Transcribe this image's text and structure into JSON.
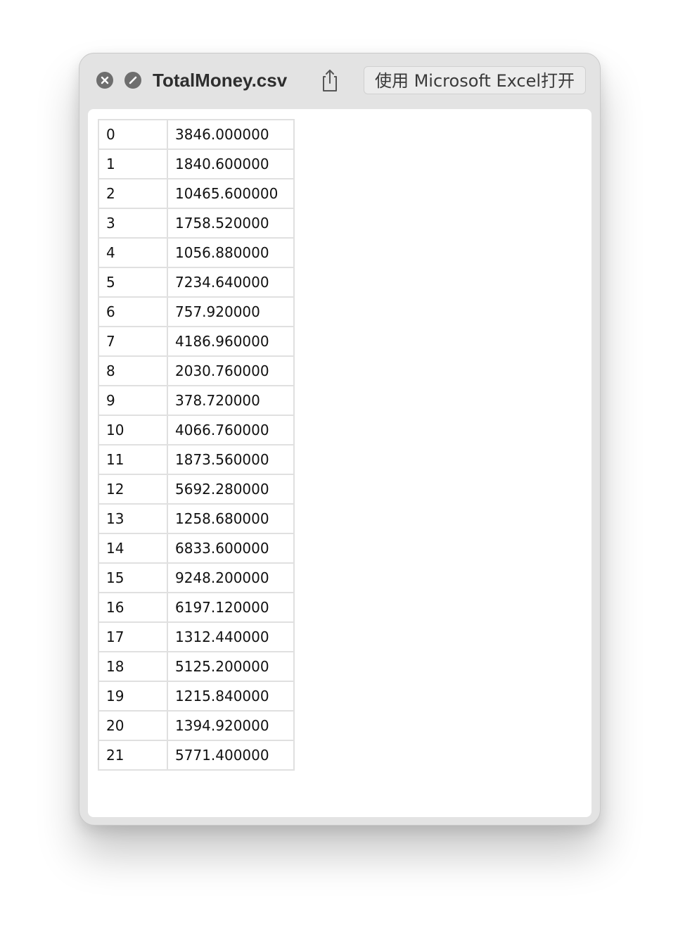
{
  "window": {
    "title": "TotalMoney.csv",
    "open_button_label": "使用 Microsoft Excel打开",
    "icons": {
      "close": "close-icon",
      "noentry": "no-entry-icon",
      "share": "share-icon"
    }
  },
  "table": {
    "rows": [
      [
        "0",
        "3846.000000"
      ],
      [
        "1",
        "1840.600000"
      ],
      [
        "2",
        "10465.600000"
      ],
      [
        "3",
        "1758.520000"
      ],
      [
        "4",
        "1056.880000"
      ],
      [
        "5",
        "7234.640000"
      ],
      [
        "6",
        "757.920000"
      ],
      [
        "7",
        "4186.960000"
      ],
      [
        "8",
        "2030.760000"
      ],
      [
        "9",
        "378.720000"
      ],
      [
        "10",
        "4066.760000"
      ],
      [
        "11",
        "1873.560000"
      ],
      [
        "12",
        "5692.280000"
      ],
      [
        "13",
        "1258.680000"
      ],
      [
        "14",
        "6833.600000"
      ],
      [
        "15",
        "9248.200000"
      ],
      [
        "16",
        "6197.120000"
      ],
      [
        "17",
        "1312.440000"
      ],
      [
        "18",
        "5125.200000"
      ],
      [
        "19",
        "1215.840000"
      ],
      [
        "20",
        "1394.920000"
      ],
      [
        "21",
        "5771.400000"
      ]
    ]
  }
}
